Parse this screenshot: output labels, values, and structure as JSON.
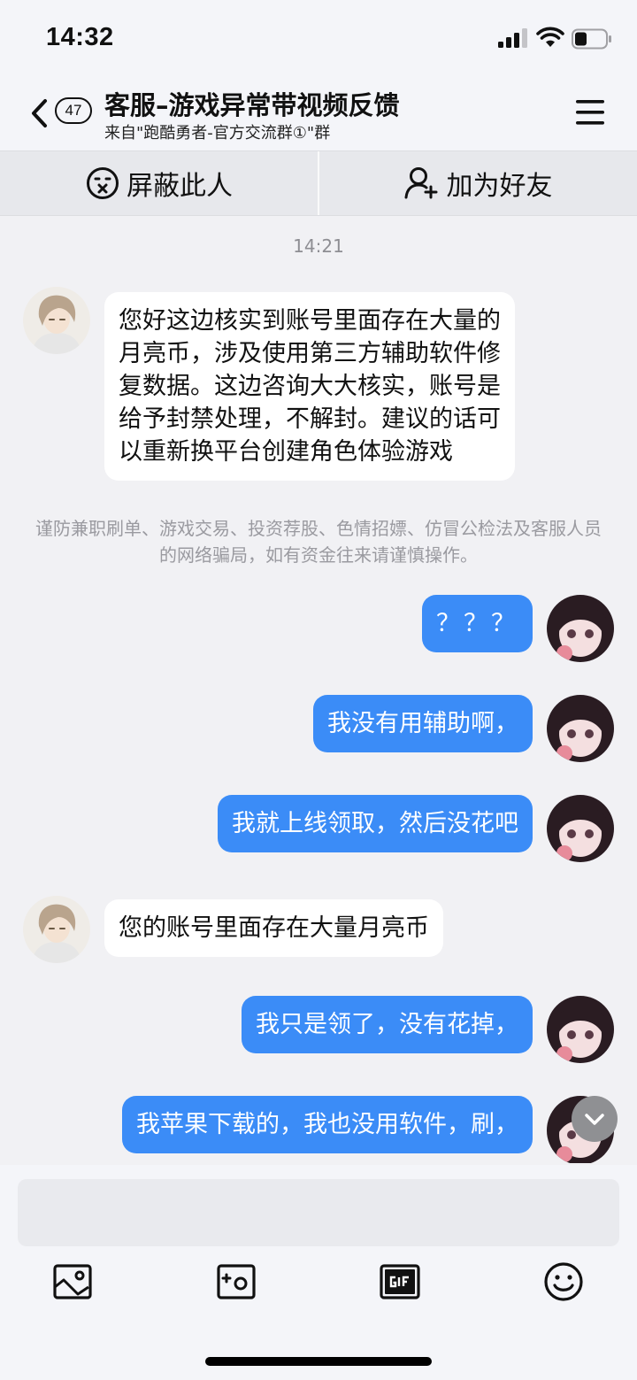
{
  "status_bar": {
    "time": "14:32"
  },
  "header": {
    "back_icon": "chevron-left-icon",
    "unread_count": "47",
    "title": "客服–游戏异常带视频反馈",
    "subtitle": "来自\"跑酷勇者-官方交流群①\"群",
    "menu_icon": "hamburger-menu-icon"
  },
  "actions": {
    "block_label": "屏蔽此人",
    "add_friend_label": "加为好友"
  },
  "chat": {
    "timestamp": "14:21",
    "messages": [
      {
        "side": "in",
        "lines": [
          "您好这边核实到账号里面存在大量的",
          "月亮币，涉及使用第三方辅助软件修",
          "复数据。这边咨询大大核实，账号是",
          "给予封禁处理，不解封。建议的话可",
          "以重新换平台创建角色体验游戏"
        ]
      },
      {
        "side": "out",
        "lines": [
          "？？？"
        ]
      },
      {
        "side": "out",
        "lines": [
          "我没有用辅助啊，"
        ]
      },
      {
        "side": "out",
        "lines": [
          "我就上线领取，然后没花吧"
        ]
      },
      {
        "side": "in",
        "lines": [
          "您的账号里面存在大量月亮币"
        ]
      },
      {
        "side": "out",
        "lines": [
          "我只是领了，没有花掉，"
        ]
      },
      {
        "side": "out",
        "lines": [
          "我苹果下载的，我也没用软件，刷，"
        ]
      }
    ],
    "safety_notice": "谨防兼职刷单、游戏交易、投资荐股、色情招嫖、仿冒公检法及客服人员的网络骗局，如有资金往来请谨慎操作。"
  },
  "input": {
    "placeholder": ""
  },
  "toolbar": [
    "image-icon",
    "camera-icon",
    "gif-icon",
    "emoji-icon"
  ],
  "colors": {
    "outgoing_bubble": "#3b8cf7",
    "incoming_bubble": "#ffffff",
    "background": "#f1f1f4"
  }
}
